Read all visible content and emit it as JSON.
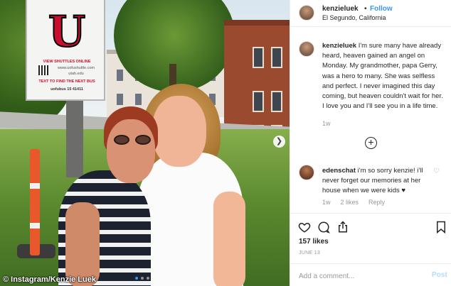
{
  "photo": {
    "credit": "© Instagram/Kenzie Luek",
    "sign": {
      "letter": "U",
      "line1": "VIEW SHUTTLES ONLINE",
      "line2": "www.uofushuttle.com",
      "line3": "utah.edu",
      "line4": "TEXT TO FIND THE NEXT BUS",
      "line5": "uofubus 15   41411"
    }
  },
  "header": {
    "username": "kenzieluek",
    "separator": "•",
    "follow_label": "Follow",
    "location": "El Segundo, California"
  },
  "caption": {
    "username": "kenzieluek",
    "text": " I'm sure many have already heard, heaven gained an angel on Monday. My grandmother, papa Gerry, was a hero to many. She was selfless and perfect. I never imagined this day coming, but heaven couldn't wait for her. I love you and I'll see you in a life time.",
    "time": "1w"
  },
  "load_more": "+",
  "comment": {
    "username": "edenschat",
    "text": " i'm so sorry kenzie! i'll never forget our memories at her house when we were kids ♥",
    "time": "1w",
    "likes": "2 likes",
    "reply": "Reply",
    "heart": "♡"
  },
  "actions": {
    "likes": "157 likes",
    "date": "JUNE 13",
    "add_comment_placeholder": "Add a comment...",
    "post_label": "Post"
  },
  "colors": {
    "link_blue": "#3897f0",
    "post_disabled": "#b3dbff",
    "text": "#262626",
    "muted": "#999999"
  }
}
